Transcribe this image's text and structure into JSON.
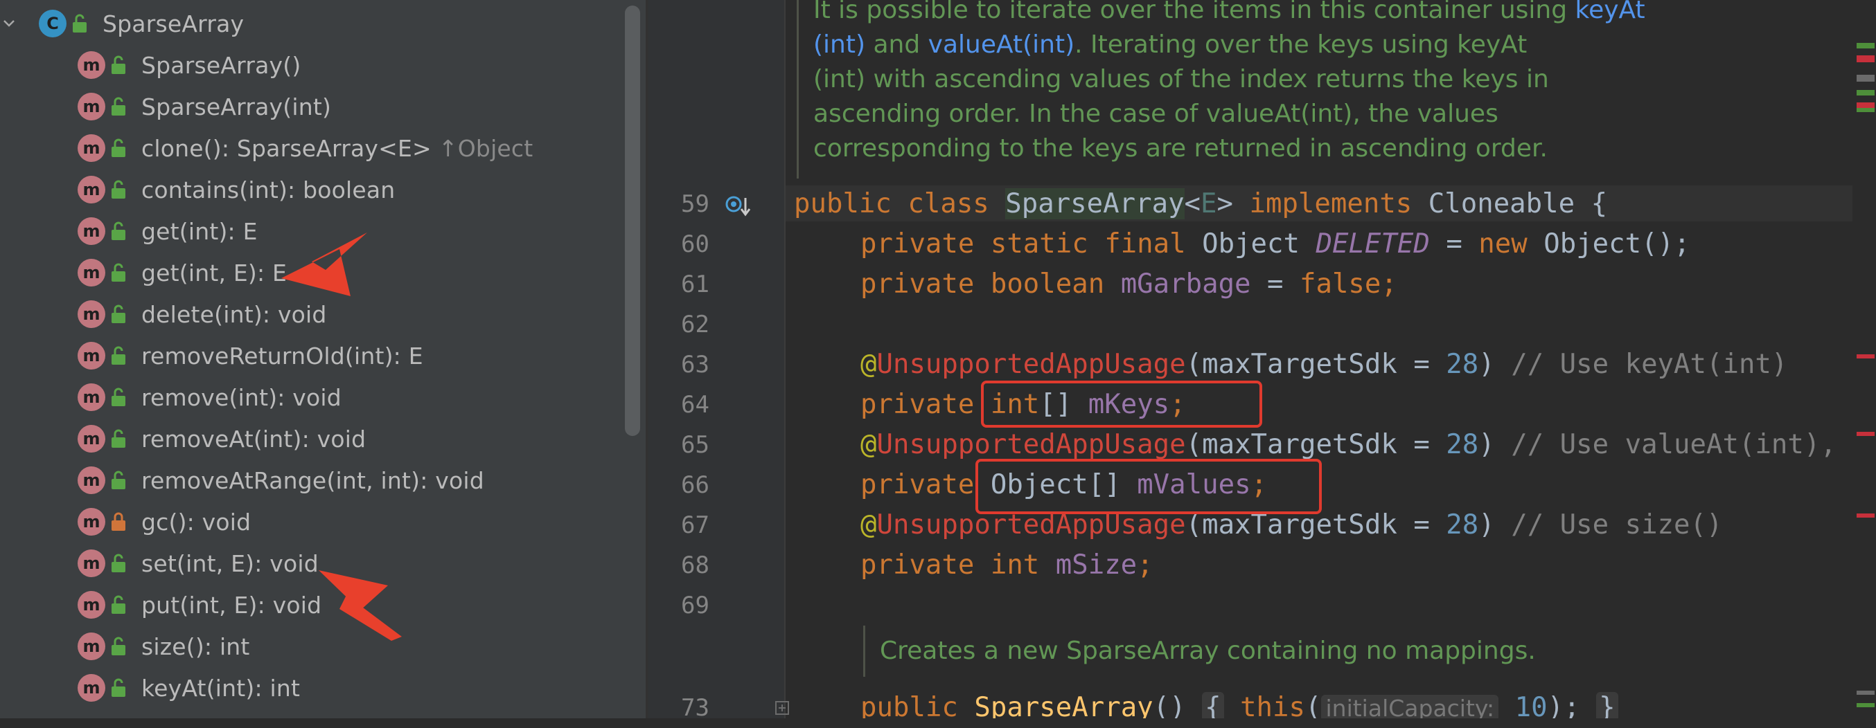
{
  "structure": {
    "root": {
      "label": "SparseArray",
      "badge": "C"
    },
    "items": [
      {
        "label": "SparseArray()",
        "badge": "m",
        "visibility": "public"
      },
      {
        "label": "SparseArray(int)",
        "badge": "m",
        "visibility": "public"
      },
      {
        "label": "clone(): SparseArray<E>",
        "suffix": "↑Object",
        "badge": "m",
        "visibility": "public"
      },
      {
        "label": "contains(int): boolean",
        "badge": "m",
        "visibility": "public"
      },
      {
        "label": "get(int): E",
        "badge": "m",
        "visibility": "public"
      },
      {
        "label": "get(int, E): E",
        "badge": "m",
        "visibility": "public"
      },
      {
        "label": "delete(int): void",
        "badge": "m",
        "visibility": "public"
      },
      {
        "label": "removeReturnOld(int): E",
        "badge": "m",
        "visibility": "public"
      },
      {
        "label": "remove(int): void",
        "badge": "m",
        "visibility": "public"
      },
      {
        "label": "removeAt(int): void",
        "badge": "m",
        "visibility": "public"
      },
      {
        "label": "removeAtRange(int, int): void",
        "badge": "m",
        "visibility": "public"
      },
      {
        "label": "gc(): void",
        "badge": "m",
        "visibility": "private"
      },
      {
        "label": "set(int, E): void",
        "badge": "m",
        "visibility": "public"
      },
      {
        "label": "put(int, E): void",
        "badge": "m",
        "visibility": "public"
      },
      {
        "label": "size(): int",
        "badge": "m",
        "visibility": "public"
      },
      {
        "label": "keyAt(int): int",
        "badge": "m",
        "visibility": "public"
      }
    ]
  },
  "editor": {
    "doc_comment": {
      "line1_a": "It is possible to iterate over the items in this container using ",
      "line1_b": "keyAt",
      "line2_a": "(int)",
      "line2_b": " and ",
      "line2_c": "valueAt(int)",
      "line2_d": ". Iterating over the keys using keyAt",
      "line3": "(int) with ascending values of the index returns the keys in",
      "line4": "ascending order. In the case of valueAt(int), the values",
      "line5": "corresponding to the keys are returned in ascending order."
    },
    "line_numbers": [
      "59",
      "60",
      "61",
      "62",
      "63",
      "64",
      "65",
      "66",
      "67",
      "68",
      "69",
      "73"
    ],
    "code": {
      "l59": {
        "k1": "public",
        "k2": "class",
        "name": "SparseArray",
        "lt": "<",
        "tp": "E",
        "gt": ">",
        "k3": "implements",
        "iface": "Cloneable {"
      },
      "l60": {
        "k": "private static final",
        "type": "Object",
        "fld": "DELETED",
        "eq": " = ",
        "k2": "new",
        "rest": "Object();",
        "semi": ""
      },
      "l61": {
        "k": "private boolean",
        "fld": "mGarbage",
        "eq": " = ",
        "val": "false",
        "semi": ";"
      },
      "l63": {
        "at": "@",
        "ann": "UnsupportedAppUsage",
        "open": "(maxTargetSdk = ",
        "num": "28",
        "close": ") ",
        "cm": "// Use keyAt(int)"
      },
      "l64": {
        "k": "private",
        "k2": "int",
        "br": "[] ",
        "fld": "mKeys",
        "semi": ";"
      },
      "l65": {
        "at": "@",
        "ann": "UnsupportedAppUsage",
        "open": "(maxTargetSdk = ",
        "num": "28",
        "close": ") ",
        "cm": "// Use valueAt(int),"
      },
      "l66": {
        "k": "private",
        "type": "Object[] ",
        "fld": "mValues",
        "semi": ";"
      },
      "l67": {
        "at": "@",
        "ann": "UnsupportedAppUsage",
        "open": "(maxTargetSdk = ",
        "num": "28",
        "close": ") ",
        "cm": "// Use size()"
      },
      "l68": {
        "k": "private int",
        "fld": "mSize",
        "semi": ";"
      },
      "l73": {
        "k": "public",
        "fn": "SparseArray",
        "paren": "() ",
        "ob": "{",
        "k2": "this",
        "open": "(",
        "hint": "initialCapacity:",
        "num": "10",
        "close": "); ",
        "cb": "}"
      }
    },
    "doc_comment2": "Creates a new SparseArray containing no mappings."
  },
  "colors": {
    "annotation_box": "#e03a2e",
    "arrow": "#e8402c"
  }
}
